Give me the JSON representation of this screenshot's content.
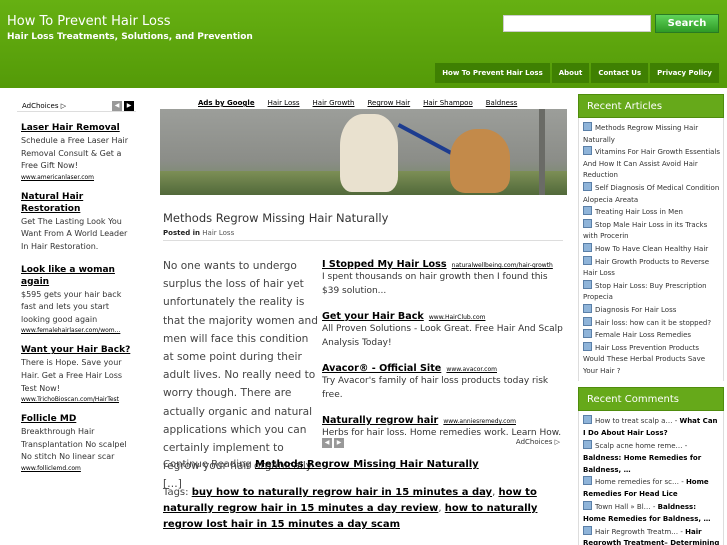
{
  "header": {
    "site_title": "How To Prevent Hair Loss",
    "site_description": "Hair Loss Treatments, Solutions, and Prevention",
    "search_placeholder": "",
    "search_button": "Search",
    "nav": [
      "How To Prevent Hair Loss",
      "About",
      "Contact Us",
      "Privacy Policy"
    ]
  },
  "left_ads": {
    "adchoices_label": "AdChoices",
    "ads": [
      {
        "title": "Laser Hair Removal",
        "text": "Schedule a Free Laser Hair Removal Consult & Get a Free Gift Now!",
        "url": "www.americanlaser.com"
      },
      {
        "title": "Natural Hair Restoration",
        "text": "Get The Lasting Look You Want From A World Leader In Hair Restoration.",
        "url": ""
      },
      {
        "title": "Look like a woman again",
        "text": "$595 gets your hair back fast and lets you start looking good again",
        "url": "www.femalehairlaser.com/wom..."
      },
      {
        "title": "Want your Hair Back?",
        "text": "There is Hope. Save your Hair. Get a Free Hair Loss Test Now!",
        "url": "www.TrichoBioscan.com/HairTest"
      },
      {
        "title": "Follicle MD",
        "text": "Breakthrough Hair Transplantation No scalpel No stitch No linear scar",
        "url": "www.folliclemd.com"
      }
    ]
  },
  "ad_links": {
    "label": "Ads by Google",
    "links": [
      "Hair Loss",
      "Hair Growth",
      "Regrow Hair",
      "Hair Shampoo",
      "Baldness"
    ]
  },
  "post": {
    "title": "Methods Regrow Missing Hair Naturally",
    "posted_in_label": "Posted in",
    "category": "Hair Loss",
    "excerpt": "No one wants to undergo surplus the loss of hair yet unfortunately the reality is that the majority women and men will face this condition at some point during their adult lives. No really need to worry though. There are actually organic and natural applications which you can certainly implement to regrow your hair organically. […]",
    "continue_label": "Continue Reading",
    "continue_link": "Methods Regrow Missing Hair Naturally",
    "tags_label": "Tags:",
    "tags": [
      "buy how to naturally regrow hair in 15 minutes a day",
      "how to naturally regrow hair in 15 minutes a day review",
      "how to naturally regrow lost hair in 15 minutes a day scam"
    ]
  },
  "center_ads": {
    "ads": [
      {
        "title": "I Stopped My Hair Loss",
        "url": "naturalwellbeing.com/hair-growth",
        "text": "I spent thousands on hair growth then I found this $39 solution..."
      },
      {
        "title": "Get your Hair Back",
        "url": "www.HairClub.com",
        "text": "All Proven Solutions - Look Great. Free Hair And Scalp Analysis Today!"
      },
      {
        "title": "Avacor® - Official Site",
        "url": "www.avacor.com",
        "text": "Try Avacor's family of hair loss products today risk free."
      },
      {
        "title": "Naturally regrow hair",
        "url": "www.anniesremedy.com",
        "text": "Herbs for hair loss. Home remedies work. Learn How."
      }
    ],
    "adchoices_label": "AdChoices"
  },
  "sidebar": {
    "recent_articles_title": "Recent Articles",
    "recent_articles": [
      "Methods Regrow Missing Hair Naturally",
      "Vitamins For Hair Growth Essentials And How It Can Assist Avoid Hair Reduction",
      "Self Diagnosis Of Medical Condition Alopecia Areata",
      "Treating Hair Loss in Men",
      "Stop Male Hair Loss in its Tracks with Procerin",
      "How To Have Clean Healthy Hair",
      "Hair Growth Products to Reverse Hair Loss",
      "Stop Hair Loss: Buy Prescription Propecia",
      "Diagnosis For Hair Loss",
      "Hair loss: how can it be stopped?",
      "Female Hair Loss Remedies",
      "Hair Loss Prevention Products Would These Herbal Products Save Your Hair ?"
    ],
    "recent_comments_title": "Recent Comments",
    "recent_comments": [
      {
        "excerpt": "How to treat scalp a…",
        "post": "What Can I Do About Hair Loss?"
      },
      {
        "excerpt": "Scalp acne home reme…",
        "post": "Baldness: Home Remedies for Baldness, …"
      },
      {
        "excerpt": "Home remedies for sc…",
        "post": "Home Remedies For Head Lice"
      },
      {
        "excerpt": "Town Hall » Bl…",
        "post": "Baldness: Home Remedies for Baldness, …"
      },
      {
        "excerpt": "Hair Regrowth Treatm…",
        "post": "Hair Regrowth Treatment– Determining"
      }
    ]
  }
}
